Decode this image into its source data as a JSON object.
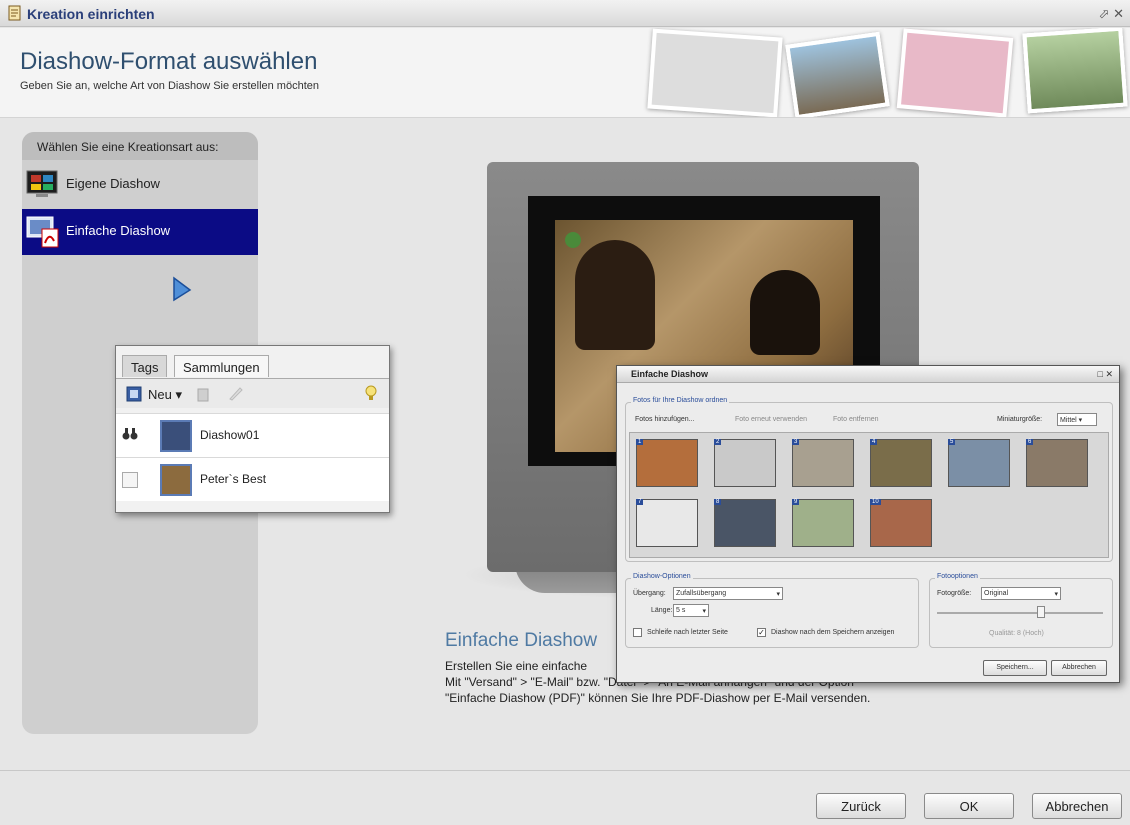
{
  "window": {
    "title": "Kreation einrichten",
    "controls": "⬀ ✕"
  },
  "header": {
    "title": "Diashow-Format auswählen",
    "subtitle": "Geben Sie an, welche Art von Diashow Sie erstellen möchten"
  },
  "left": {
    "header": "Wählen Sie eine Kreationsart aus:",
    "options": [
      {
        "label": "Eigene Diashow",
        "icon": "slideshow-icon"
      },
      {
        "label": "Einfache Diashow",
        "icon": "pdf-slideshow-icon",
        "selected": true
      }
    ]
  },
  "tags_panel": {
    "tabs": [
      "Tags",
      "Sammlungen"
    ],
    "new_label": "Neu",
    "items": [
      {
        "label": "Diashow01"
      },
      {
        "label": "Peter`s Best"
      }
    ]
  },
  "preview": {
    "title": "Einfache Diashow",
    "lines": [
      "Erstellen Sie eine einfache",
      "Mit \"Versand\" > \"E-Mail\" bzw. \"Datei\" > \"An E-Mail anhängen\" und der Option",
      "\"Einfache Diashow (PDF)\" können Sie Ihre PDF-Diashow per E-Mail versenden."
    ]
  },
  "dialog": {
    "title": "Einfache Diashow",
    "section_photos": "Fotos für Ihre Diashow ordnen",
    "add_photos": "Fotos hinzufügen...",
    "reuse_photo": "Foto erneut verwenden",
    "remove_photo": "Foto entfernen",
    "thumb_size_label": "Miniaturgröße:",
    "thumb_size_value": "Mittel",
    "photo_numbers": [
      "1",
      "2",
      "3",
      "4",
      "5",
      "6",
      "7",
      "8",
      "9",
      "10"
    ],
    "section_options": "Diashow-Optionen",
    "transition_label": "Übergang:",
    "transition_value": "Zufallsübergang",
    "length_label": "Länge:",
    "length_value": "5 s",
    "loop_label": "Schleife nach letzter Seite",
    "show_after_save_label": "Diashow nach dem Speichern anzeigen",
    "section_photo_opts": "Fotooptionen",
    "photo_size_label": "Fotogröße:",
    "photo_size_value": "Original",
    "quality_label": "Qualität: 8 (Hoch)",
    "save_button": "Speichern...",
    "cancel_button": "Abbrechen"
  },
  "footer": {
    "back": "Zurück",
    "ok": "OK",
    "cancel": "Abbrechen"
  },
  "colors": {
    "selection": "#0b0b85",
    "title_blue": "#2a3f7a",
    "accent": "#4f7aa3"
  }
}
